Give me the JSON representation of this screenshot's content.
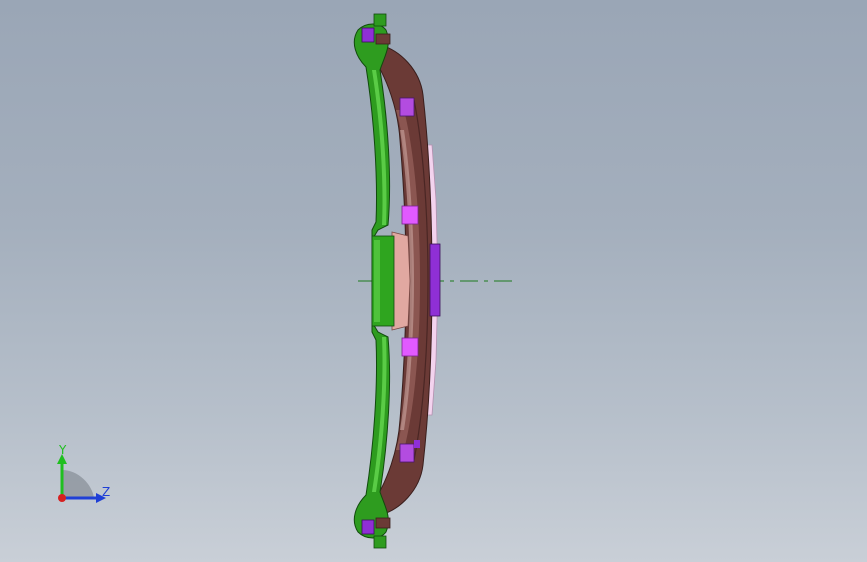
{
  "triad": {
    "y_label": "Y",
    "z_label": "Z",
    "colors": {
      "y_axis": "#1fbf1f",
      "z_axis": "#1f3fd6",
      "x_axis": "#d62020",
      "plane": "#8f96a0"
    }
  },
  "model": {
    "icon": "clutch-pressure-plate-side-view",
    "colors": {
      "green_part": "#2e9c1f",
      "green_highlight": "#5fd24a",
      "brown_body": "#6b3a36",
      "brown_light": "#b78a83",
      "rose_hub": "#e1a8a1",
      "magenta_blocks": "#e15aff",
      "violet_blocks": "#8f2fd6",
      "pink_plate": "#f3d3ee",
      "centerline": "#1d7a1d"
    }
  }
}
